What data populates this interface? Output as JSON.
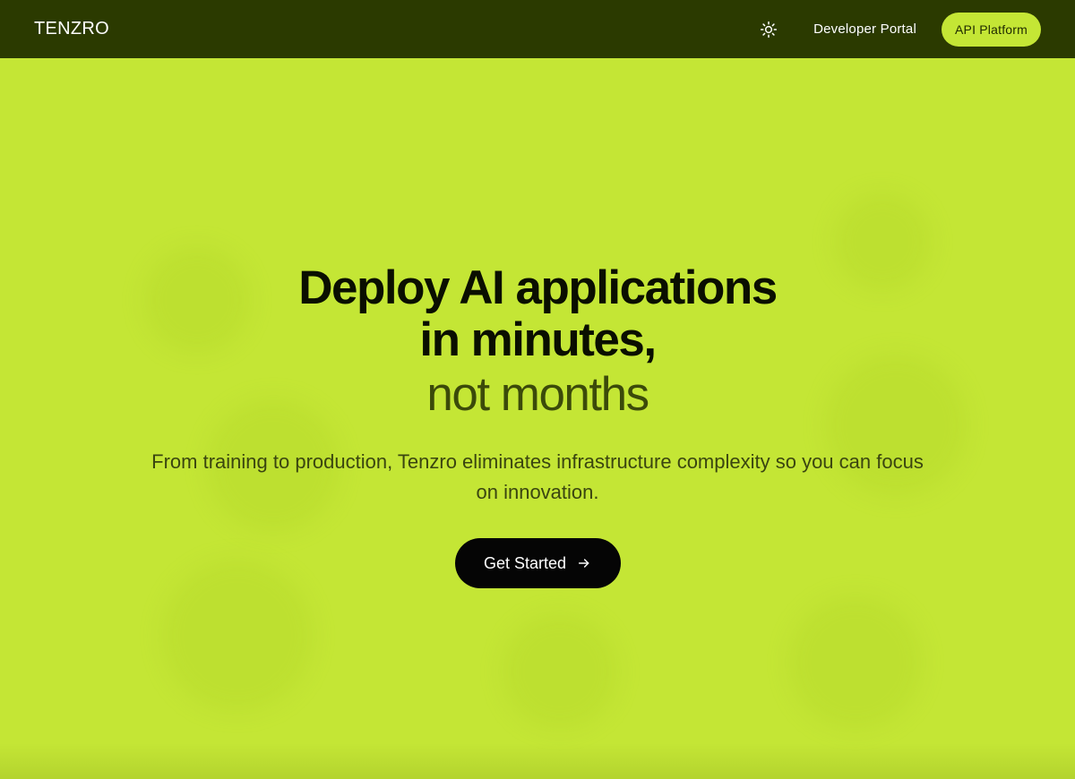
{
  "navbar": {
    "brand": "TENZRO",
    "theme_icon": "sun-icon",
    "links": [
      {
        "label": "Developer Portal"
      }
    ],
    "cta_label": "API Platform"
  },
  "hero": {
    "headline_line1": "Deploy AI applications",
    "headline_line2": "in minutes,",
    "headline_accent": "not months",
    "subtext": "From training to production, Tenzro eliminates infrastructure complexity so you can focus on innovation.",
    "cta_label": "Get Started",
    "cta_icon": "arrow-right-icon"
  },
  "colors": {
    "navbar_bg": "#2b3a00",
    "accent": "#c4e635",
    "button_bg": "#050505",
    "text_dark": "#0a0f00",
    "text_muted": "#3b4a0a"
  }
}
